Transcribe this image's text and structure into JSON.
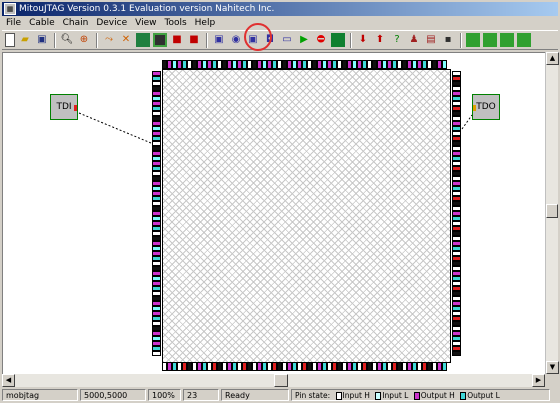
{
  "window": {
    "title": "MitouJTAG Version 0.3.1 Evaluation version  Nahitech Inc."
  },
  "menu": [
    "File",
    "Cable",
    "Chain",
    "Device",
    "View",
    "Tools",
    "Help"
  ],
  "toolbar": {
    "groups": [
      [
        "new-file-icon",
        "open-folder-icon",
        "save-icon"
      ],
      [
        "zoom-icon",
        "zoom-fit-icon"
      ],
      [
        "connect-cable-icon",
        "disconnect-cable-icon",
        "detect-chain-icon",
        "device-icon",
        "add-device-icon",
        "remove-device-icon"
      ],
      [
        "pin-view-icon",
        "pin-view-2-icon",
        "boundary-scan-icon",
        "pin-view-3-icon",
        "monitor-icon",
        "run-icon",
        "stop-icon",
        "sample-icon"
      ],
      [
        "download-icon",
        "upload-icon",
        "help-icon",
        "person-icon",
        "print-icon",
        "chip-icon"
      ],
      [
        "grid-icon-1",
        "grid-icon-2",
        "grid-icon-3",
        "grid-icon-4"
      ]
    ]
  },
  "diagram": {
    "tdi_label": "TDI",
    "tdo_label": "TDO"
  },
  "pin_colors": {
    "input_h": "#ffffff",
    "input_l": "#7fffff",
    "output_h": "#cc33cc",
    "output_l": "#3fd8d8",
    "ground": "#101010",
    "red": "#e02020"
  },
  "status": {
    "project": "mobjtag",
    "coords": "5000,5000",
    "zoom": "100%",
    "count": "23",
    "state": "Ready",
    "pin_state_label": "Pin state:",
    "legend": [
      {
        "label": "Input H",
        "color": "#ffffff"
      },
      {
        "label": "Input L",
        "color": "#c8ffff"
      },
      {
        "label": "Output H",
        "color": "#cc33cc"
      },
      {
        "label": "Output L",
        "color": "#3fd8d8"
      }
    ]
  }
}
